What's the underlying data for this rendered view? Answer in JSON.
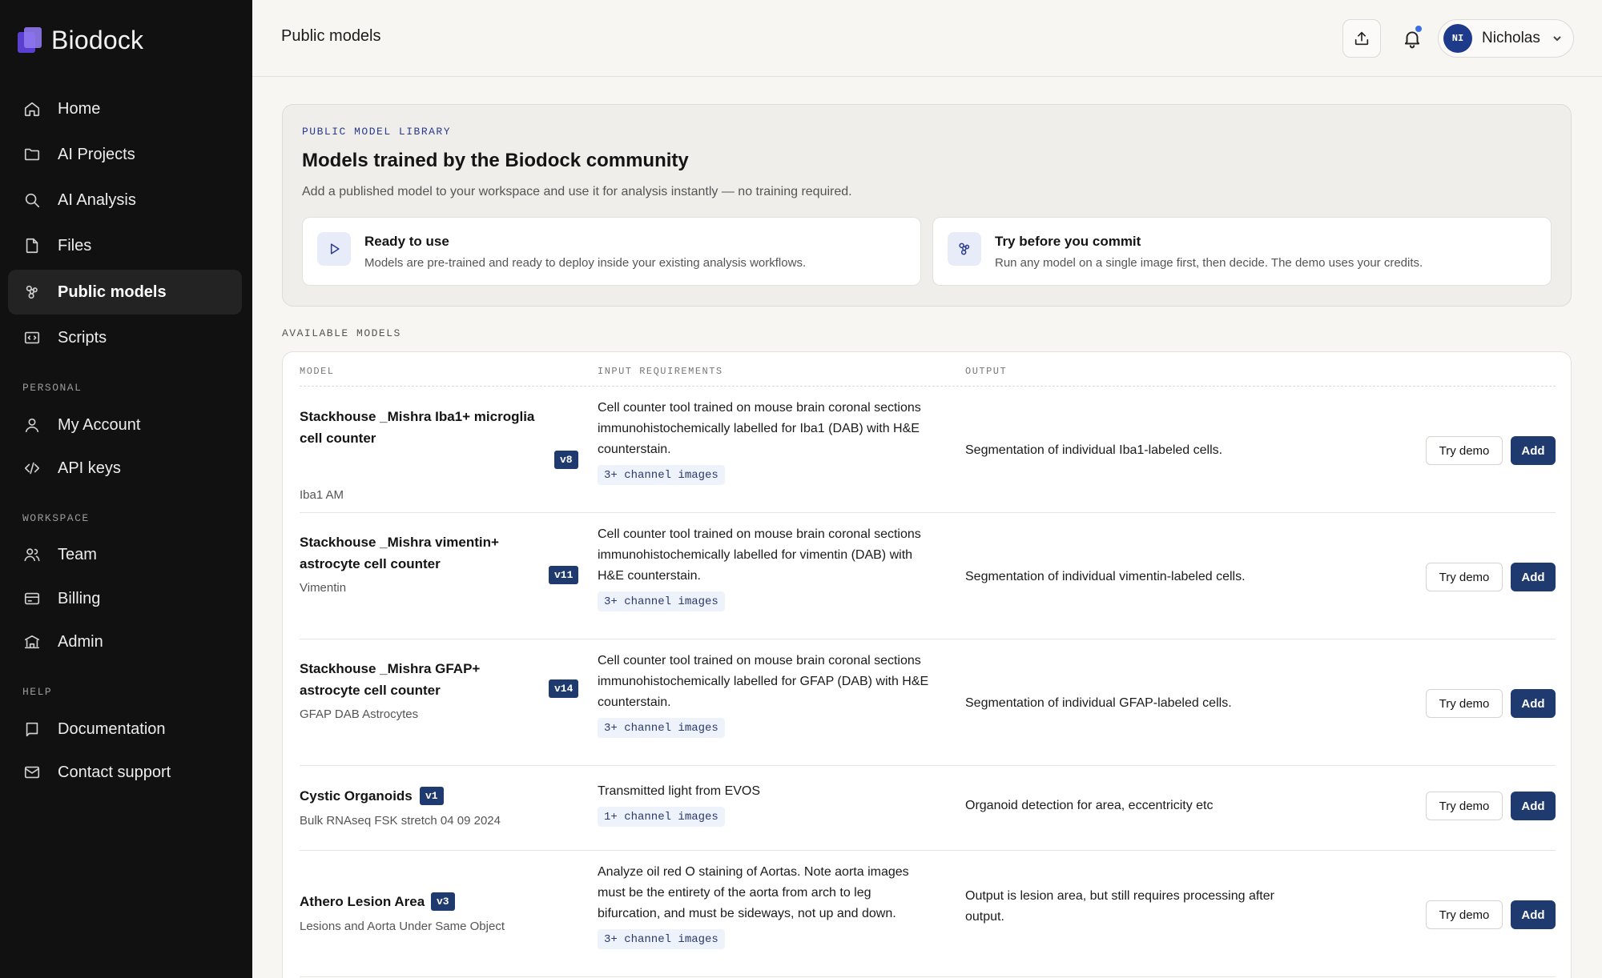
{
  "brand": {
    "name": "Biodock"
  },
  "sidebar": {
    "main": [
      {
        "label": "Home",
        "icon": "home-icon"
      },
      {
        "label": "AI Projects",
        "icon": "folder-icon"
      },
      {
        "label": "AI Analysis",
        "icon": "search-icon"
      },
      {
        "label": "Files",
        "icon": "file-icon"
      },
      {
        "label": "Public models",
        "icon": "models-icon",
        "active": true
      },
      {
        "label": "Scripts",
        "icon": "code-icon"
      }
    ],
    "personal_label": "PERSONAL",
    "personal": [
      {
        "label": "My Account",
        "icon": "user-icon"
      },
      {
        "label": "API keys",
        "icon": "code-brackets-icon"
      }
    ],
    "workspace_label": "WORKSPACE",
    "workspace": [
      {
        "label": "Team",
        "icon": "team-icon"
      },
      {
        "label": "Billing",
        "icon": "credit-card-icon"
      },
      {
        "label": "Admin",
        "icon": "bank-icon"
      }
    ],
    "help_label": "HELP",
    "help": [
      {
        "label": "Documentation",
        "icon": "book-icon"
      },
      {
        "label": "Contact support",
        "icon": "mail-icon"
      }
    ]
  },
  "header": {
    "title": "Public models",
    "user": {
      "initials": "NI",
      "name": "Nicholas"
    }
  },
  "library": {
    "eyebrow": "PUBLIC MODEL LIBRARY",
    "title": "Models trained by the Biodock community",
    "subtitle": "Add a published model to your workspace and use it for analysis instantly — no training required.",
    "features": [
      {
        "title": "Ready to use",
        "desc": "Models are pre-trained and ready to deploy inside your existing analysis workflows.",
        "icon": "play-icon"
      },
      {
        "title": "Try before you commit",
        "desc": "Run any model on a single image first, then decide. The demo uses your credits.",
        "icon": "models-icon"
      }
    ]
  },
  "available_label": "AVAILABLE MODELS",
  "table": {
    "columns": [
      "MODEL",
      "INPUT REQUIREMENTS",
      "OUTPUT"
    ],
    "rows": [
      {
        "name_lines": [
          "Stackhouse _Mishra Iba1+ microglia",
          "cell counter"
        ],
        "version": "v8",
        "subtitle": "Iba1 AM",
        "req_lines": [
          "Cell counter tool trained on mouse brain coronal sections",
          "immunohistochemically labelled for Iba1 (DAB) with H&E",
          "counterstain."
        ],
        "chip": "3+ channel images",
        "output_lines": [
          "Segmentation of individual Iba1-labeled cells."
        ]
      },
      {
        "name_lines": [
          "Stackhouse _Mishra vimentin+",
          "astrocyte cell counter"
        ],
        "version": "v11",
        "subtitle": "Vimentin",
        "req_lines": [
          "Cell counter tool trained on mouse brain coronal sections",
          "immunohistochemically labelled for vimentin (DAB) with",
          "H&E counterstain."
        ],
        "chip": "3+ channel images",
        "output_lines": [
          "Segmentation of individual vimentin-labeled cells."
        ]
      },
      {
        "name_lines": [
          "Stackhouse _Mishra GFAP+",
          "astrocyte cell counter"
        ],
        "version": "v14",
        "subtitle": "GFAP DAB Astrocytes",
        "req_lines": [
          "Cell counter tool trained on mouse brain coronal sections",
          "immunohistochemically labelled for GFAP (DAB) with H&E",
          "counterstain."
        ],
        "chip": "3+ channel images",
        "output_lines": [
          "Segmentation of individual GFAP-labeled cells."
        ]
      },
      {
        "name_lines": [
          "Cystic Organoids"
        ],
        "version": "v1",
        "subtitle": "Bulk RNAseq FSK stretch 04 09 2024",
        "req_lines": [
          "Transmitted light from EVOS"
        ],
        "chip": "1+ channel images",
        "output_lines": [
          "Organoid detection for area, eccentricity etc"
        ]
      },
      {
        "name_lines": [
          "Athero Lesion Area"
        ],
        "version": "v3",
        "subtitle": "Lesions and Aorta Under Same Object",
        "req_lines": [
          "Analyze oil red O staining of Aortas. Note aorta images",
          "must be the entirety of the aorta from arch to leg",
          "bifurcation, and must be sideways, not up and down."
        ],
        "chip": "3+ channel images",
        "output_lines": [
          "Output is lesion area, but still requires processing after",
          "output."
        ]
      }
    ],
    "try_demo_label": "Try demo",
    "add_label": "Add"
  },
  "colors": {
    "sidebar_bg": "#111111",
    "accent_navy": "#1e3a6e",
    "notification_dot": "#3b6fe0",
    "brand_purple": "#5b3fd1"
  }
}
